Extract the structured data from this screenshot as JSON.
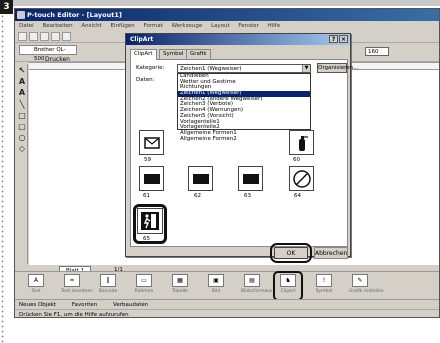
{
  "page": {
    "step_number": "3"
  },
  "window": {
    "title": "P-touch Editor - [Layout1]"
  },
  "menu": [
    "Datei",
    "Bearbeiten",
    "Ansicht",
    "Einfügen",
    "Format",
    "Werkzeuge",
    "Layout",
    "Fenster",
    "Hilfe"
  ],
  "printer": {
    "name": "Brother QL-500",
    "print_label": "Drucken"
  },
  "dialog": {
    "title": "ClipArt",
    "tabs": [
      "ClipArt",
      "Symbol",
      "Grafik"
    ],
    "kategorie_label": "Kategorie:",
    "kategorie_value": "Zeichen1 (Wegweiser)",
    "organize_button": "Organisieren...",
    "daten_label": "Daten:",
    "dropdown_items": [
      "Landleben",
      "Wetter und Gestirne",
      "Richtungen",
      "Zeichen1 (Wegweiser)",
      "Zeichen2 (andere Wegweiser)",
      "Zeichen3 (Verbote)",
      "Zeichen4 (Warnungen)",
      "Zeichen5 (Vorsicht)",
      "Vorlagenteile1",
      "Vorlagenteile2",
      "Allgemeine Formen1",
      "Allgemeine Formen2"
    ],
    "selected_index": 3,
    "tile_numbers": [
      "59",
      "60",
      "61",
      "62",
      "63",
      "64",
      "65"
    ],
    "ok_button": "OK",
    "cancel_button": "Abbrechen"
  },
  "zoom": {
    "value": "160"
  },
  "pagebar": {
    "tab": "Blatt 1",
    "page": "1/1"
  },
  "bottom_tools": [
    "Text",
    "Text anordnen",
    "Barcode",
    "Rahmen",
    "Tabelle",
    "Bild",
    "Bildschirmaus...",
    "Clipart",
    "Symbol",
    "Grafik erstellen"
  ],
  "status": {
    "new_object": "Neues Objekt",
    "favorites": "Favoriten",
    "database": "Verbaudaten"
  },
  "help": {
    "text": "Drücken Sie F1, um die Hilfe aufzurufen"
  }
}
